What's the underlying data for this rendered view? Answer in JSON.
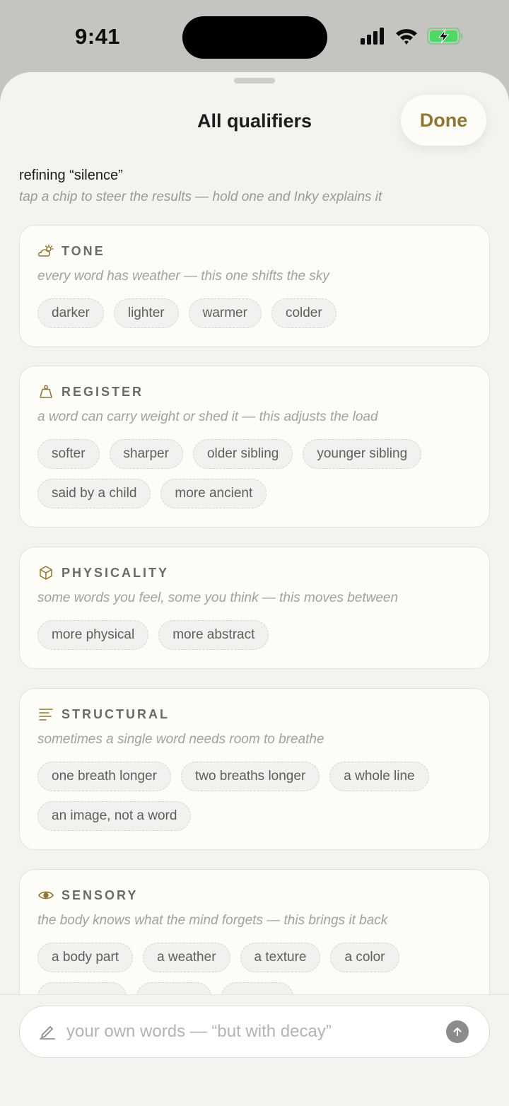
{
  "status_bar": {
    "time": "9:41"
  },
  "sheet": {
    "title": "All qualifiers",
    "done_label": "Done",
    "refining": "refining “silence”",
    "hint": "tap a chip to steer the results — hold one and Inky explains it"
  },
  "colors": {
    "accent": "#8e7633",
    "battery_green": "#4cd964",
    "sheet_bg": "#f4f3ef",
    "card_bg": "#fdfcf7"
  },
  "sections": [
    {
      "icon": "cloud-sun-icon",
      "title": "TONE",
      "description": "every word has weather — this one shifts the sky",
      "chips": [
        "darker",
        "lighter",
        "warmer",
        "colder"
      ]
    },
    {
      "icon": "weight-icon",
      "title": "REGISTER",
      "description": "a word can carry weight or shed it — this adjusts the load",
      "chips": [
        "softer",
        "sharper",
        "older sibling",
        "younger sibling",
        "said by a child",
        "more ancient"
      ]
    },
    {
      "icon": "cube-icon",
      "title": "PHYSICALITY",
      "description": "some words you feel, some you think — this moves between",
      "chips": [
        "more physical",
        "more abstract"
      ]
    },
    {
      "icon": "text-lines-icon",
      "title": "STRUCTURAL",
      "description": "sometimes a single word needs room to breathe",
      "chips": [
        "one breath longer",
        "two breaths longer",
        "a whole line",
        "an image, not a word"
      ]
    },
    {
      "icon": "eye-icon",
      "title": "SENSORY",
      "description": "the body knows what the mind forgets — this brings it back",
      "chips": [
        "a body part",
        "a weather",
        "a texture",
        "a color"
      ]
    }
  ],
  "composer": {
    "placeholder": "your own words — “but with decay”",
    "icon": "pencil-icon",
    "send_icon": "arrow-up-icon"
  }
}
